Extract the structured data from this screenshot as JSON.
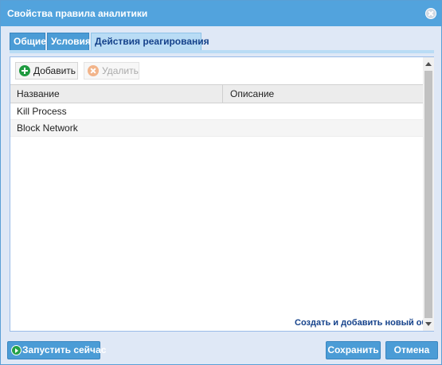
{
  "window": {
    "title": "Свойства правила аналитики"
  },
  "tabs": [
    {
      "label": "Общие"
    },
    {
      "label": "Условия"
    },
    {
      "label": "Действия реагирования"
    }
  ],
  "toolbar": {
    "add_label": "Добавить",
    "delete_label": "Удалить"
  },
  "table": {
    "columns": [
      "Название",
      "Описание"
    ],
    "rows": [
      {
        "name": "Kill Process",
        "description": ""
      },
      {
        "name": "Block Network",
        "description": ""
      }
    ]
  },
  "create_link": "Создать и добавить новый объект",
  "footer": {
    "run_now_label": "Запустить сейчас",
    "save_label": "Сохранить",
    "cancel_label": "Отмена"
  },
  "colors": {
    "header": "#52a3dd",
    "active_tab": "#b9dcf5",
    "link": "#15428b"
  },
  "icons": {
    "close": "close-icon",
    "add": "add-icon",
    "delete": "delete-icon",
    "run": "run-icon"
  }
}
